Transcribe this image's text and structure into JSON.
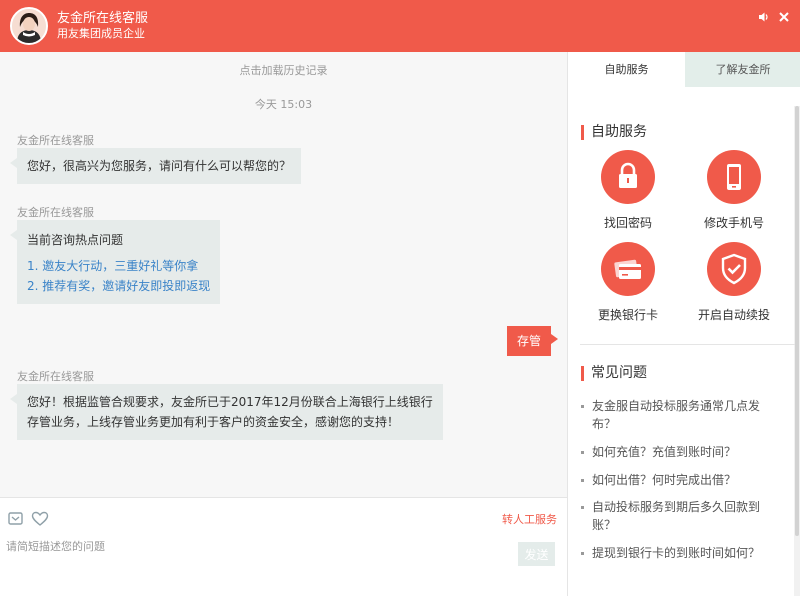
{
  "header": {
    "title": "友金所在线客服",
    "subtitle": "用友集团成员企业",
    "icons": [
      "speaker-icon",
      "close-icon"
    ]
  },
  "chat": {
    "history_link": "点击加载历史记录",
    "timestamp": "今天 15:03",
    "messages": [
      {
        "sender": "友金所在线客服",
        "text": "您好，很高兴为您服务，请问有什么可以帮您的？"
      },
      {
        "sender": "友金所在线客服",
        "title": "当前咨询热点问题",
        "links": [
          "1. 邀友大行动，三重好礼等你拿",
          "2. 推荐有奖，邀请好友即投即返现"
        ]
      },
      {
        "sender": "user",
        "text": "存管"
      },
      {
        "sender": "友金所在线客服",
        "lines": [
          "您好！根据监管合规要求，友金所已于2017年12月份联合上海银行上线银行",
          "存管业务，上线存管业务更加有利于客户的资金安全，感谢您的支持！"
        ]
      }
    ]
  },
  "input": {
    "placeholder": "请简短描述您的问题",
    "value": "",
    "transfer_label": "转人工服务",
    "send_label": "发送",
    "tool_icons": [
      "comment-icon",
      "heart-icon"
    ]
  },
  "sidebar": {
    "tabs": [
      {
        "label": "自助服务",
        "active": true
      },
      {
        "label": "了解友金所",
        "active": false
      }
    ],
    "self_service": {
      "title": "自助服务",
      "items": [
        {
          "label": "找回密码",
          "icon": "lock-icon"
        },
        {
          "label": "修改手机号",
          "icon": "phone-icon"
        },
        {
          "label": "更换银行卡",
          "icon": "card-icon"
        },
        {
          "label": "开启自动续投",
          "icon": "shield-check-icon"
        }
      ]
    },
    "faq": {
      "title": "常见问题",
      "items": [
        {
          "line1": "友金服自动投标服务通常几点发",
          "line2": "布？"
        },
        {
          "line1": "如何充值？充值到账时间？",
          "line2": ""
        },
        {
          "line1": "如何出借？何时完成出借？",
          "line2": ""
        },
        {
          "line1": "自动投标服务到期后多久回款到",
          "line2": "账？"
        },
        {
          "line1": "提现到银行卡的到账时间如何？",
          "line2": ""
        }
      ]
    }
  },
  "colors": {
    "brand": "#f05a4a",
    "link": "#3a83c8",
    "bubble": "#e6ebea",
    "tab_inactive": "#e3eeea"
  }
}
